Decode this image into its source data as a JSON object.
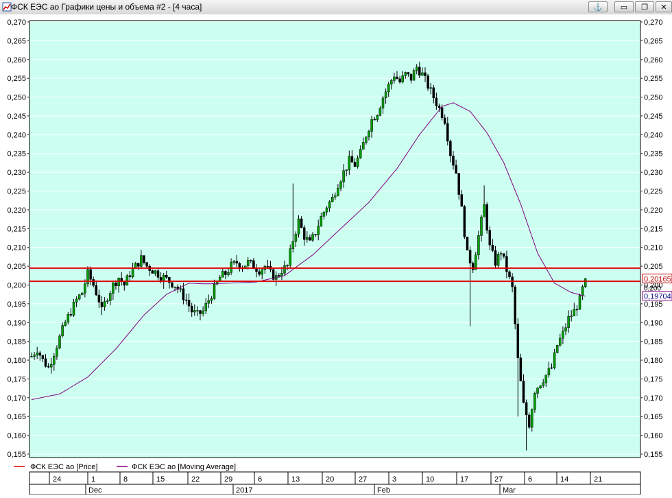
{
  "window": {
    "title": "ФСК ЕЭС ао Графики цены и объема #2 - [4 часа]",
    "buttons": [
      {
        "name": "anchor-button",
        "glyph": "⚓"
      },
      {
        "name": "minimize-button",
        "glyph": "▭"
      },
      {
        "name": "restore-button",
        "glyph": "❐"
      },
      {
        "name": "close-button",
        "glyph": "✕"
      }
    ]
  },
  "chart_data": {
    "type": "candlestick",
    "background": "#ccfff0",
    "y_range": [
      0.155,
      0.27
    ],
    "y_ticks": [
      "0,270",
      "0,265",
      "0,260",
      "0,255",
      "0,250",
      "0,245",
      "0,240",
      "0,235",
      "0,230",
      "0,225",
      "0,220",
      "0,215",
      "0,210",
      "0,205",
      "0,200",
      "0,195",
      "0,190",
      "0,185",
      "0,180",
      "0,175",
      "0,170",
      "0,165",
      "0,160",
      "0,155"
    ],
    "horizontal_lines": [
      {
        "value": 0.2045,
        "color": "#e00000"
      },
      {
        "value": 0.201,
        "color": "#e00000"
      }
    ],
    "price_label": {
      "text": "0,20165",
      "value": 0.20165,
      "color": "#c00000"
    },
    "ma_label": {
      "text": "0,19704",
      "value": 0.19704,
      "color": "#800080"
    },
    "overlap_label": "0,200",
    "legend": [
      {
        "label": "ФСК ЕЭС ао [Price]",
        "color": "#e00000"
      },
      {
        "label": "ФСК ЕЭС ао [Moving Average]",
        "color": "#800080"
      }
    ],
    "x_days": [
      "24",
      "1",
      "8",
      "15",
      "22",
      "29",
      "6",
      "13",
      "20",
      "27",
      "3",
      "10",
      "17",
      "27",
      "6",
      "14",
      "21"
    ],
    "x_months": [
      "Dec",
      "2017",
      "Feb",
      "Mar"
    ],
    "price_anchors": [
      [
        0,
        0.181
      ],
      [
        2,
        0.183
      ],
      [
        4,
        0.18
      ],
      [
        6,
        0.178
      ],
      [
        8,
        0.182
      ],
      [
        10,
        0.186
      ],
      [
        12,
        0.19
      ],
      [
        14,
        0.193
      ],
      [
        16,
        0.196
      ],
      [
        18,
        0.198
      ],
      [
        20,
        0.203
      ],
      [
        22,
        0.2
      ],
      [
        24,
        0.196
      ],
      [
        25,
        0.193
      ],
      [
        27,
        0.197
      ],
      [
        29,
        0.2
      ],
      [
        31,
        0.202
      ],
      [
        33,
        0.2
      ],
      [
        35,
        0.203
      ],
      [
        37,
        0.205
      ],
      [
        39,
        0.207
      ],
      [
        41,
        0.205
      ],
      [
        43,
        0.204
      ],
      [
        45,
        0.203
      ],
      [
        47,
        0.202
      ],
      [
        49,
        0.201
      ],
      [
        51,
        0.2
      ],
      [
        53,
        0.198
      ],
      [
        55,
        0.196
      ],
      [
        57,
        0.193
      ],
      [
        59,
        0.192
      ],
      [
        61,
        0.193
      ],
      [
        63,
        0.196
      ],
      [
        65,
        0.199
      ],
      [
        67,
        0.202
      ],
      [
        69,
        0.203
      ],
      [
        71,
        0.205
      ],
      [
        73,
        0.206
      ],
      [
        75,
        0.205
      ],
      [
        77,
        0.206
      ],
      [
        79,
        0.205
      ],
      [
        81,
        0.204
      ],
      [
        83,
        0.205
      ],
      [
        85,
        0.203
      ],
      [
        87,
        0.202
      ],
      [
        89,
        0.204
      ],
      [
        91,
        0.205
      ],
      [
        93,
        0.212
      ],
      [
        95,
        0.217
      ],
      [
        97,
        0.213
      ],
      [
        99,
        0.211
      ],
      [
        101,
        0.214
      ],
      [
        103,
        0.218
      ],
      [
        105,
        0.221
      ],
      [
        107,
        0.223
      ],
      [
        109,
        0.227
      ],
      [
        111,
        0.23
      ],
      [
        113,
        0.233
      ],
      [
        115,
        0.232
      ],
      [
        117,
        0.235
      ],
      [
        119,
        0.24
      ],
      [
        121,
        0.244
      ],
      [
        123,
        0.246
      ],
      [
        125,
        0.25
      ],
      [
        127,
        0.253
      ],
      [
        129,
        0.256
      ],
      [
        131,
        0.254
      ],
      [
        133,
        0.256
      ],
      [
        135,
        0.255
      ],
      [
        137,
        0.258
      ],
      [
        139,
        0.256
      ],
      [
        141,
        0.253
      ],
      [
        143,
        0.25
      ],
      [
        145,
        0.247
      ],
      [
        147,
        0.244
      ],
      [
        149,
        0.235
      ],
      [
        151,
        0.23
      ],
      [
        153,
        0.22
      ],
      [
        155,
        0.208
      ],
      [
        157,
        0.205
      ],
      [
        159,
        0.213
      ],
      [
        161,
        0.221
      ],
      [
        163,
        0.21
      ],
      [
        165,
        0.206
      ],
      [
        167,
        0.209
      ],
      [
        169,
        0.204
      ],
      [
        171,
        0.199
      ],
      [
        173,
        0.18
      ],
      [
        175,
        0.168
      ],
      [
        177,
        0.163
      ],
      [
        179,
        0.172
      ],
      [
        181,
        0.174
      ],
      [
        183,
        0.176
      ],
      [
        185,
        0.178
      ],
      [
        187,
        0.184
      ],
      [
        189,
        0.187
      ],
      [
        191,
        0.191
      ],
      [
        193,
        0.193
      ],
      [
        195,
        0.196
      ],
      [
        197,
        0.2017
      ]
    ],
    "ma_anchors": [
      [
        0,
        0.1695
      ],
      [
        10,
        0.171
      ],
      [
        20,
        0.1755
      ],
      [
        30,
        0.183
      ],
      [
        40,
        0.192
      ],
      [
        48,
        0.1975
      ],
      [
        56,
        0.2005
      ],
      [
        62,
        0.2003
      ],
      [
        70,
        0.2005
      ],
      [
        80,
        0.2008
      ],
      [
        90,
        0.2025
      ],
      [
        100,
        0.208
      ],
      [
        110,
        0.215
      ],
      [
        120,
        0.222
      ],
      [
        130,
        0.231
      ],
      [
        138,
        0.24
      ],
      [
        146,
        0.2475
      ],
      [
        150,
        0.2485
      ],
      [
        156,
        0.2462
      ],
      [
        162,
        0.2405
      ],
      [
        168,
        0.2325
      ],
      [
        174,
        0.2215
      ],
      [
        180,
        0.2085
      ],
      [
        186,
        0.2005
      ],
      [
        192,
        0.198
      ],
      [
        197,
        0.197
      ]
    ],
    "shocks": [
      [
        20,
        0.205,
        null
      ],
      [
        25,
        null,
        0.192
      ],
      [
        47,
        null,
        0.199
      ],
      [
        93,
        0.227,
        null
      ],
      [
        156,
        null,
        0.189
      ],
      [
        161,
        0.2265,
        null
      ],
      [
        173,
        null,
        0.165
      ],
      [
        176,
        null,
        0.156
      ],
      [
        178,
        null,
        0.161
      ]
    ]
  }
}
